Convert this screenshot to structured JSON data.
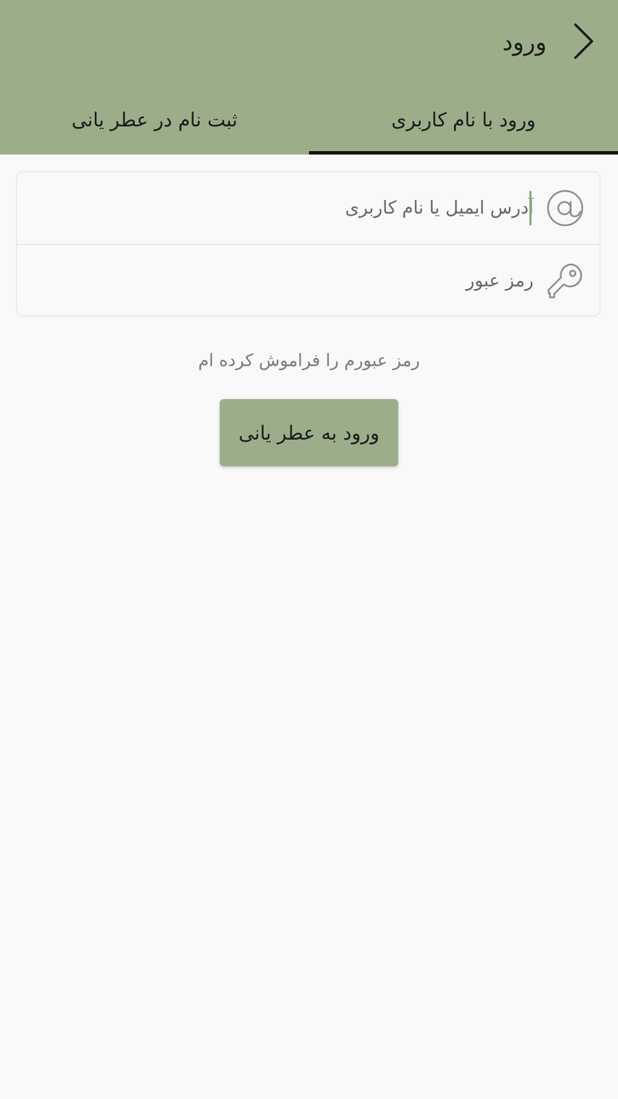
{
  "header": {
    "title": "ورود",
    "back_icon": "chevron-right-icon",
    "background_color": "#9cae89"
  },
  "tabs": [
    {
      "label": "ورود با نام کاربری",
      "selected": true
    },
    {
      "label": "ثبت نام در عطر یانی",
      "selected": false
    }
  ],
  "form": {
    "email": {
      "icon": "at-sign-icon",
      "placeholder": "آدرس ایمیل یا نام کاربری",
      "value": ""
    },
    "password": {
      "icon": "key-icon",
      "placeholder": "رمز عبور",
      "value": ""
    }
  },
  "forgot_password_label": "رمز عبورم را فراموش کرده ام",
  "submit_label": "ورود به عطر یانی",
  "colors": {
    "accent": "#9cae89",
    "tab_indicator": "#141414",
    "background": "#f9f9f9"
  }
}
